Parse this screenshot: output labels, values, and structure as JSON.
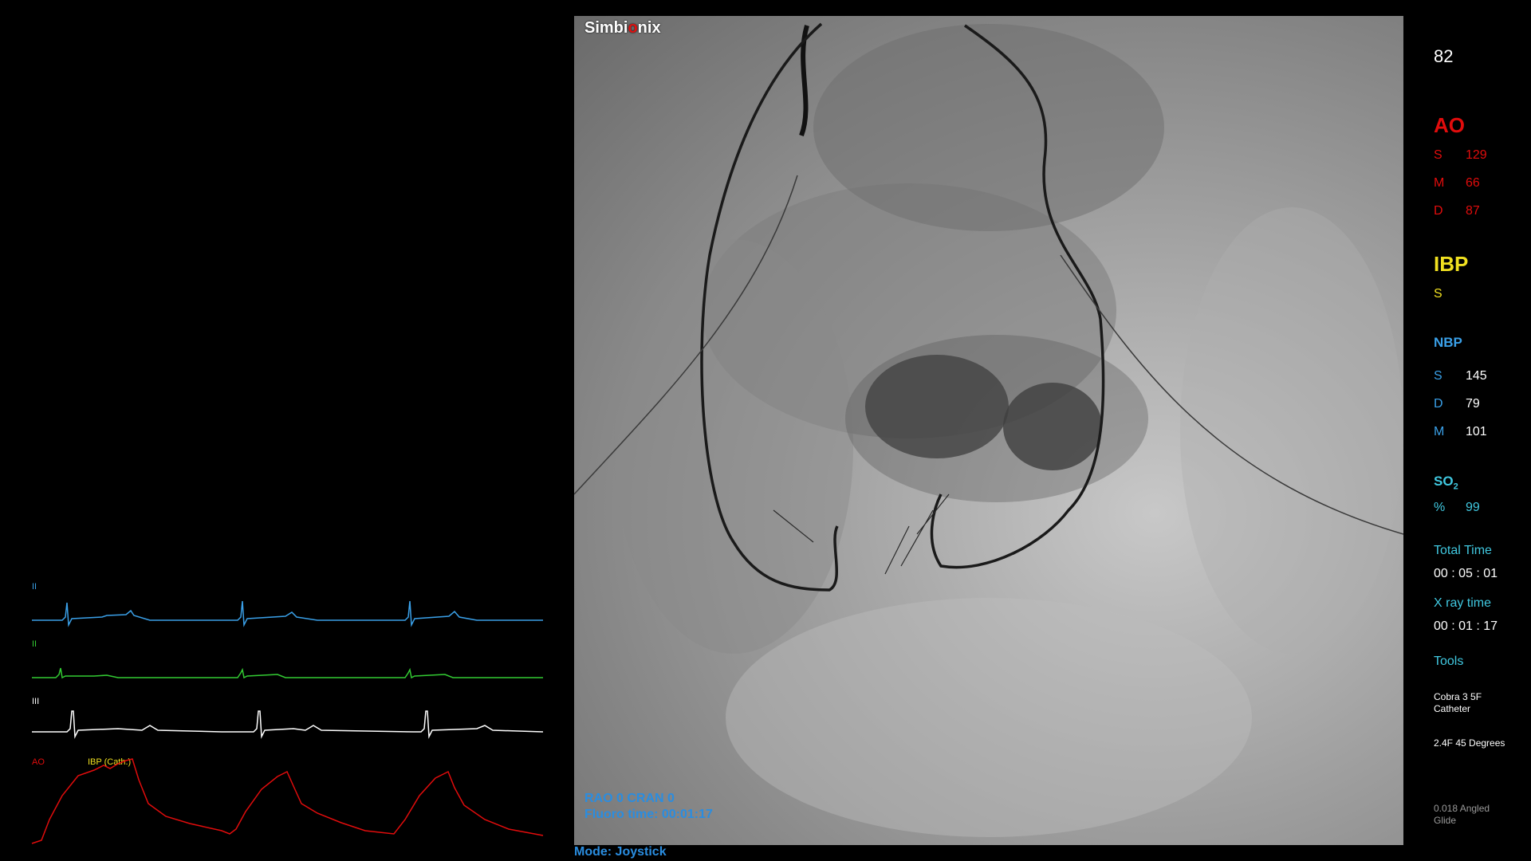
{
  "viewer": {
    "logo_text_a": "Simbi",
    "logo_text_b": "o",
    "logo_text_c": "nix",
    "projection": "RAO   0 CRAN   0",
    "fluoro_time": "Fluoro time:  00:01:17",
    "mode": "Mode: Joystick"
  },
  "waveforms": {
    "lead1_label": "II",
    "lead2_label": "II",
    "lead3_label": "III",
    "ao_label": "AO",
    "ibp_label": "IBP (Cath.)",
    "colors": {
      "lead1": "#3aa0e8",
      "lead2": "#33cc33",
      "lead3": "#ffffff",
      "ao": "#e10c0c",
      "ibp": "#f0e020"
    }
  },
  "panel": {
    "hr": "82",
    "ao": {
      "title": "AO",
      "s_label": "S",
      "s": "129",
      "m_label": "M",
      "m": "66",
      "d_label": "D",
      "d": "87"
    },
    "ibp": {
      "title": "IBP",
      "s_label": "S"
    },
    "nbp": {
      "title": "NBP",
      "s_label": "S",
      "s": "145",
      "d_label": "D",
      "d": "79",
      "m_label": "M",
      "m": "101"
    },
    "so2": {
      "title": "SO",
      "sub": "2",
      "pct_label": "%",
      "pct": "99"
    },
    "total_time_label": "Total Time",
    "total_time": "00 : 05 : 01",
    "xray_time_label": "X ray time",
    "xray_time": "00 : 01 : 17",
    "tools_label": "Tools",
    "tool1": "Cobra 3 5F Catheter",
    "tool2": "2.4F 45 Degrees",
    "tool3": "0.018 Angled Glide"
  }
}
